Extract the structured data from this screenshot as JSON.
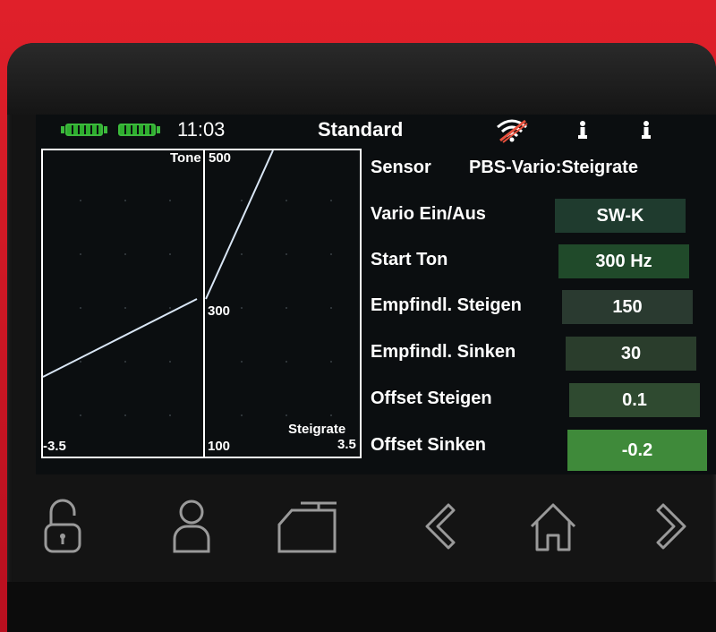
{
  "status": {
    "time": "11:03",
    "title": "Standard",
    "wifi_icon": "wifi-off-icon",
    "colors": {
      "battery": "#3cba3c",
      "wifi_strike": "#e8503c"
    }
  },
  "graph": {
    "label_tone": "Tone",
    "label_500": "500",
    "label_300": "300",
    "label_100": "100",
    "label_neg": "-3.5",
    "label_pos": "3.5",
    "label_axis": "Steigrate"
  },
  "settings": {
    "sensor_label": "Sensor",
    "sensor_value": "PBS-Vario:Steigrate",
    "rows": [
      {
        "label": "Vario Ein/Aus",
        "value": "SW-K"
      },
      {
        "label": "Start Ton",
        "value": "300 Hz"
      },
      {
        "label": "Empfindl. Steigen",
        "value": "150"
      },
      {
        "label": "Empfindl. Sinken",
        "value": "30"
      },
      {
        "label": "Offset Steigen",
        "value": "0.1"
      },
      {
        "label": "Offset Sinken",
        "value": "-0.2"
      }
    ]
  },
  "nav": {
    "items": [
      "lock-open-icon",
      "user-icon",
      "model-icon",
      "back-icon",
      "home-icon",
      "forward-icon"
    ]
  }
}
